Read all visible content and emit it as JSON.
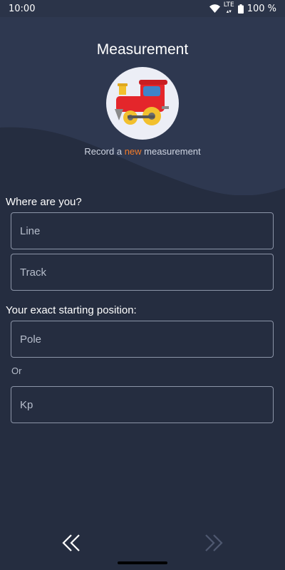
{
  "status_bar": {
    "time": "10:00",
    "network": "LTE",
    "battery": "100 %"
  },
  "header": {
    "title": "Measurement",
    "subtitle_prefix": "Record a ",
    "subtitle_highlight": "new",
    "subtitle_suffix": " measurement",
    "avatar_icon": "train-icon"
  },
  "location_section": {
    "label": "Where are you?",
    "line": {
      "value": "",
      "placeholder": "Line"
    },
    "track": {
      "value": "",
      "placeholder": "Track"
    }
  },
  "position_section": {
    "label": "Your exact starting position:",
    "pole": {
      "value": "",
      "placeholder": "Pole"
    },
    "or_label": "Or",
    "kp": {
      "value": "",
      "placeholder": "Kp"
    }
  },
  "navigation": {
    "back_icon": "double-chevron-left-icon",
    "next_icon": "double-chevron-right-icon"
  },
  "colors": {
    "background": "#252d40",
    "header_background": "#2e3850",
    "accent": "#f37b2a",
    "field_border": "#8c95a8"
  }
}
